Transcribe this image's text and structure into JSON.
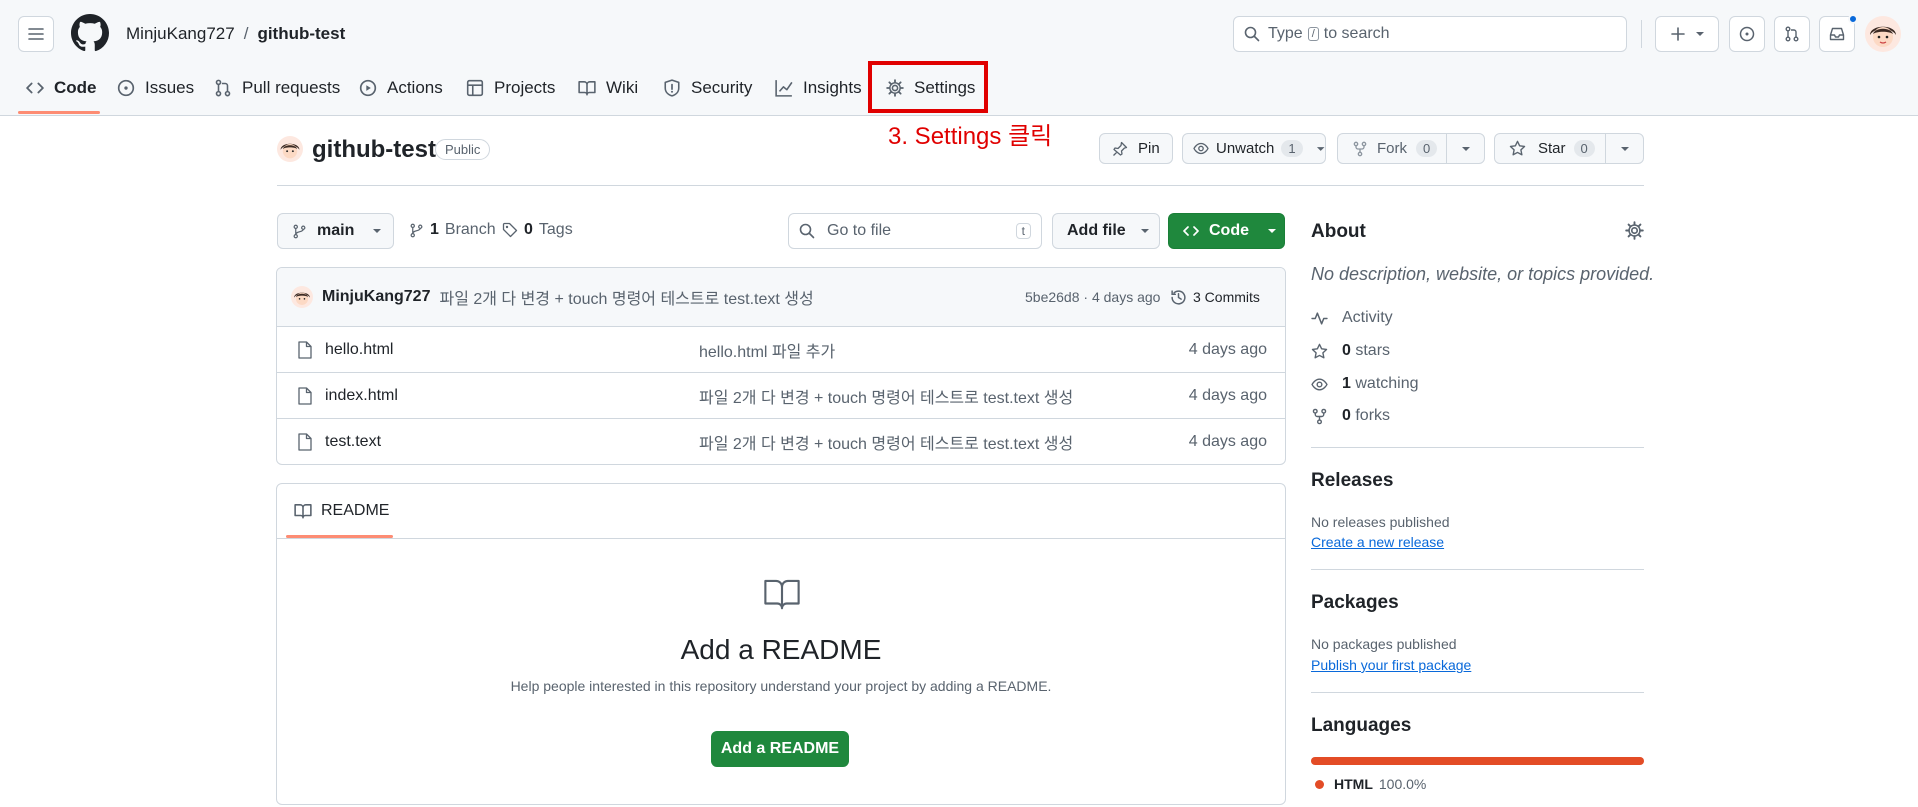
{
  "header": {
    "owner": "MinjuKang727",
    "separator": "/",
    "repo": "github-test",
    "search_placeholder_pre": "Type",
    "search_key": "/",
    "search_placeholder_post": "to search"
  },
  "tabs": [
    {
      "label": "Code",
      "icon": "code-icon"
    },
    {
      "label": "Issues",
      "icon": "issue-icon"
    },
    {
      "label": "Pull requests",
      "icon": "pull-request-icon"
    },
    {
      "label": "Actions",
      "icon": "play-icon"
    },
    {
      "label": "Projects",
      "icon": "table-icon"
    },
    {
      "label": "Wiki",
      "icon": "book-icon"
    },
    {
      "label": "Security",
      "icon": "shield-icon"
    },
    {
      "label": "Insights",
      "icon": "graph-icon"
    },
    {
      "label": "Settings",
      "icon": "gear-icon"
    }
  ],
  "annotation": "3. Settings 클릭",
  "repo_head": {
    "name": "github-test",
    "visibility": "Public",
    "pin": "Pin",
    "unwatch": "Unwatch",
    "watch_count": "1",
    "fork": "Fork",
    "fork_count": "0",
    "star": "Star",
    "star_count": "0"
  },
  "toolbar": {
    "branch": "main",
    "branches_count": "1",
    "branches_label": "Branch",
    "tags_count": "0",
    "tags_label": "Tags",
    "goto_placeholder": "Go to file",
    "goto_key": "t",
    "add_file": "Add file",
    "code": "Code"
  },
  "commit": {
    "author": "MinjuKang727",
    "message": "파일 2개 다 변경 + touch 명령어 테스트로 test.text 생성",
    "hash_time": "5be26d8 · 4 days ago",
    "commits": "3 Commits"
  },
  "files": [
    {
      "name": "hello.html",
      "message": "hello.html 파일 추가",
      "time": "4 days ago"
    },
    {
      "name": "index.html",
      "message": "파일 2개 다 변경 + touch 명령어 테스트로 test.text 생성",
      "time": "4 days ago"
    },
    {
      "name": "test.text",
      "message": "파일 2개 다 변경 + touch 명령어 테스트로 test.text 생성",
      "time": "4 days ago"
    }
  ],
  "readme": {
    "tab": "README",
    "title": "Add a README",
    "desc": "Help people interested in this repository understand your project by adding a README.",
    "button": "Add a README"
  },
  "about": {
    "title": "About",
    "desc": "No description, website, or topics provided.",
    "activity": "Activity",
    "stars_n": "0",
    "stars": "stars",
    "watching_n": "1",
    "watching": "watching",
    "forks_n": "0",
    "forks": "forks"
  },
  "releases": {
    "title": "Releases",
    "none": "No releases published",
    "link": "Create a new release"
  },
  "packages": {
    "title": "Packages",
    "none": "No packages published",
    "link": "Publish your first package"
  },
  "languages": {
    "title": "Languages",
    "name": "HTML",
    "percent": "100.0%",
    "fraction": 1.0,
    "color": "#e34c26"
  },
  "colors": {
    "accent_green": "#1f883d",
    "annotation_red": "#e00000",
    "tab_underline": "#fd8c73"
  }
}
